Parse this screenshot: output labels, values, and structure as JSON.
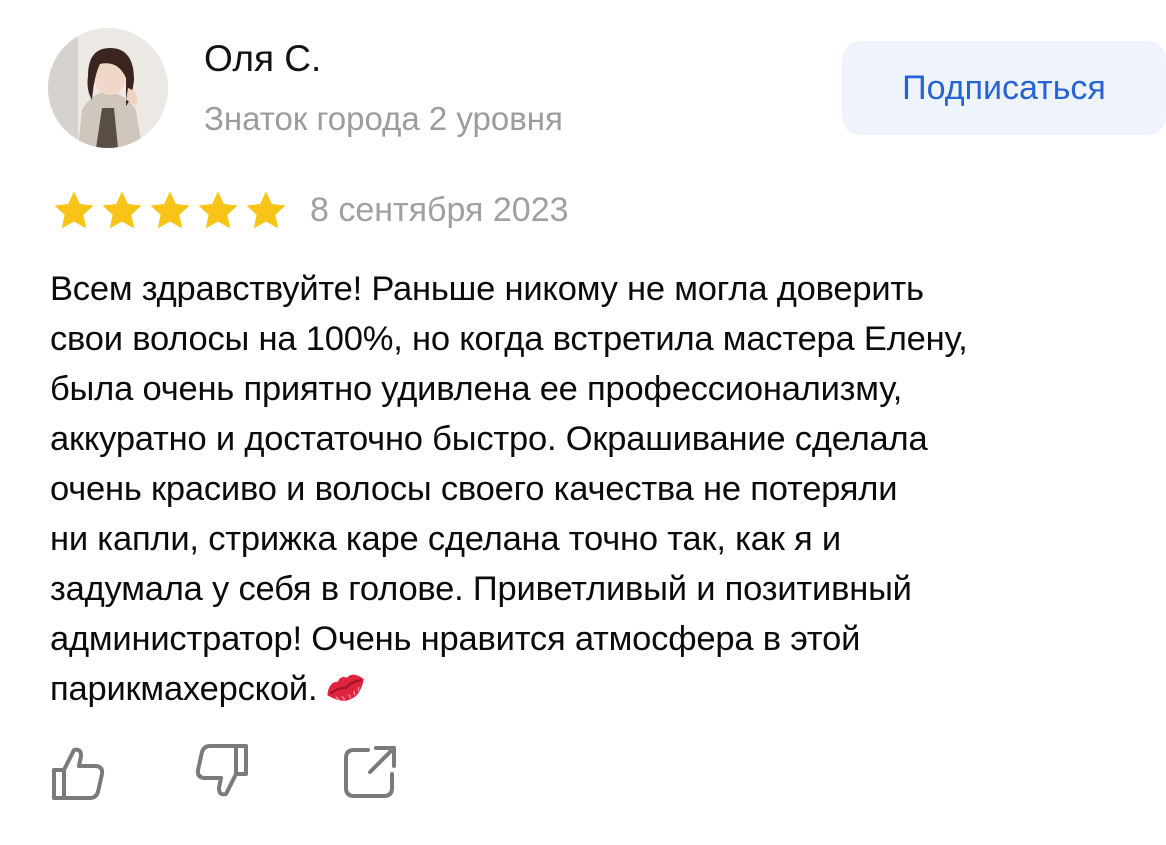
{
  "author": {
    "name": "Оля С.",
    "level": "Знаток города 2 уровня"
  },
  "subscribe": {
    "label": "Подписаться"
  },
  "review": {
    "rating": 5,
    "rating_max": 5,
    "date": "8 сентября 2023",
    "lines": [
      "Всем здравствуйте! Раньше никому не могла доверить",
      "свои волосы на 100%, но когда встретила мастера Елену,",
      "была очень приятно удивлена ее профессионализму,",
      "аккуратно и достаточно быстро. Окрашивание сделала",
      "очень красиво и волосы своего качества не потеряли",
      "ни капли, стрижка каре сделана точно так, как я и",
      "задумала у себя в голове. Приветливый и позитивный",
      "администратор! Очень нравится атмосфера в этой",
      "парикмахерской."
    ],
    "trailing_emoji": "kiss-mark-icon"
  },
  "actions": {
    "like": "thumbs-up-icon",
    "dislike": "thumbs-down-icon",
    "share": "share-icon"
  },
  "colors": {
    "star": "#f8c417",
    "subscribe_bg": "#eef3fc",
    "subscribe_text": "#2563d8",
    "secondary_text": "#9c9c9c",
    "icon": "#7a7a7a"
  }
}
